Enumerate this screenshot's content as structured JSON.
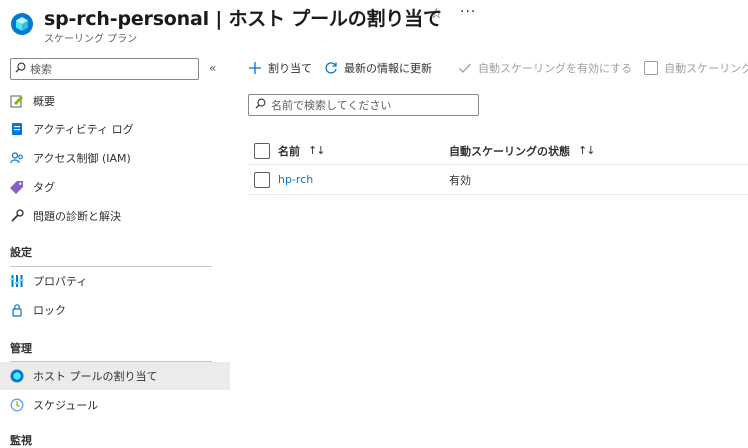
{
  "header": {
    "title": "sp-rch-personal | ホスト プールの割り当て",
    "subtitle": "スケーリング プラン",
    "favorite_icon": "star-icon",
    "more_label": "···"
  },
  "sidebar": {
    "search_placeholder": "検索",
    "collapse_label": "«",
    "items_top": [
      {
        "label": "概要",
        "icon": "overview-icon"
      },
      {
        "label": "アクティビティ ログ",
        "icon": "activity-log-icon"
      },
      {
        "label": "アクセス制御 (IAM)",
        "icon": "iam-icon"
      },
      {
        "label": "タグ",
        "icon": "tag-icon"
      },
      {
        "label": "問題の診断と解決",
        "icon": "wrench-icon"
      }
    ],
    "section_settings": "設定",
    "items_settings": [
      {
        "label": "プロパティ",
        "icon": "properties-icon"
      },
      {
        "label": "ロック",
        "icon": "lock-icon"
      }
    ],
    "section_manage": "管理",
    "items_manage": [
      {
        "label": "ホスト プールの割り当て",
        "icon": "host-pool-icon",
        "active": true
      },
      {
        "label": "スケジュール",
        "icon": "clock-icon"
      }
    ],
    "section_monitor": "監視"
  },
  "toolbar": {
    "assign_label": "割り当て",
    "refresh_label": "最新の情報に更新",
    "enable_label": "自動スケーリングを有効にする",
    "disable_label": "自動スケーリングを"
  },
  "filter": {
    "placeholder": "名前で検索してください"
  },
  "table": {
    "columns": [
      {
        "label": "名前",
        "sort": "↑↓"
      },
      {
        "label": "自動スケーリングの状態",
        "sort": "↑↓"
      }
    ],
    "rows": [
      {
        "name": "hp-rch",
        "status": "有効"
      }
    ]
  },
  "colors": {
    "accent": "#0078d4",
    "active_bg": "#edebe9",
    "disabled_text": "#a19f9d"
  }
}
